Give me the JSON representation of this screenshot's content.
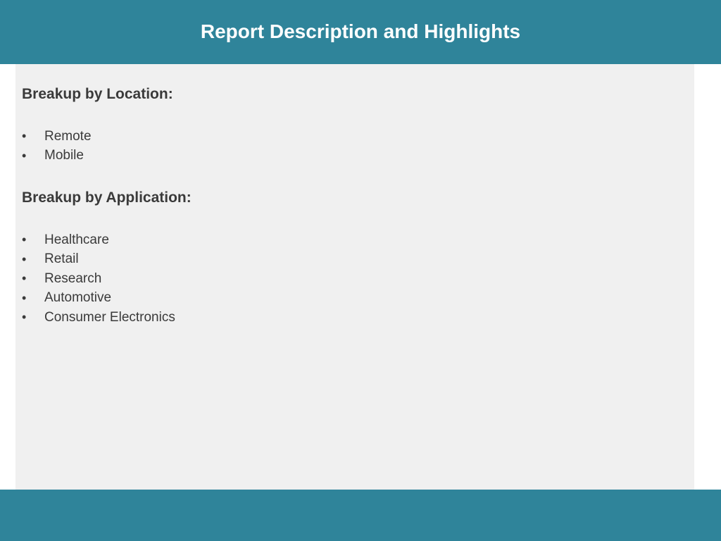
{
  "header": {
    "title": "Report Description and Highlights"
  },
  "sections": [
    {
      "heading": "Breakup by Location:",
      "items": [
        "Remote",
        "Mobile"
      ]
    },
    {
      "heading": "Breakup by Application:",
      "items": [
        "Healthcare",
        "Retail",
        "Research",
        "Automotive",
        "Consumer Electronics"
      ]
    }
  ],
  "bullet_glyph": "•",
  "colors": {
    "accent_bar": "#2f849a",
    "panel_background": "#f0f0f0",
    "text": "#3a3a3a",
    "title_text": "#ffffff"
  }
}
